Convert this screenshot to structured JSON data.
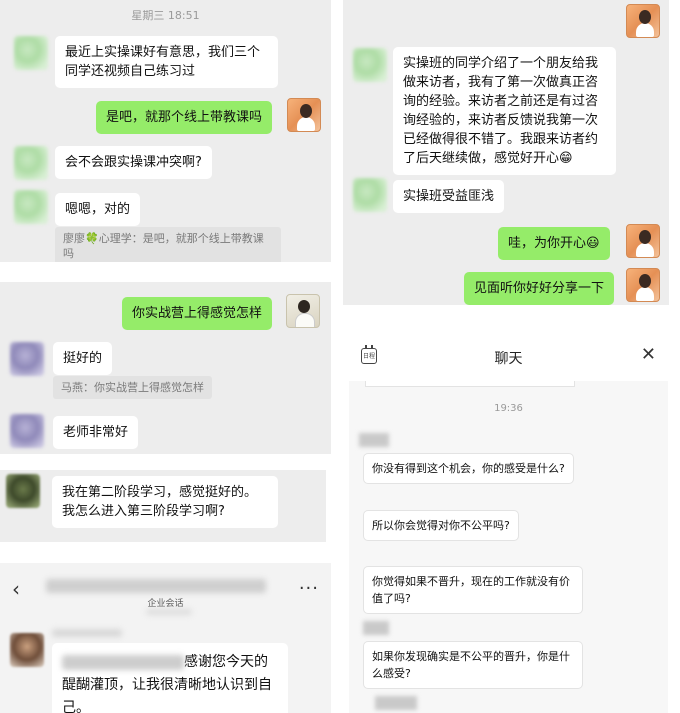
{
  "panel1": {
    "time": "星期三 18:51",
    "msg1": "最近上实操课好有意思，我们三个同学还视频自己练习过",
    "msg2": "是吧，就那个线上带教课吗",
    "msg3": "会不会跟实操课冲突啊?",
    "msg4": "嗯嗯，对的",
    "quote": "廖廖🍀心理学：是吧，就那个线上带教课吗"
  },
  "panel2": {
    "msg1": "你实战营上得感觉怎样",
    "msg2": "挺好的",
    "quote": "马燕：你实战营上得感觉怎样",
    "msg3": "老师非常好"
  },
  "panel3": {
    "msg1_line1": "我在第二阶段学习，感觉挺好的。",
    "msg1_line2": "我怎么进入第三阶段学习啊?"
  },
  "panel4": {
    "back_icon": "‹",
    "more_icon": "···",
    "subtitle": "企业会话",
    "msg_text": "感谢您今天的醍醐灌顶，让我很清晰地认识到自己。"
  },
  "panel5": {
    "msg1": "实操班的同学介绍了一个朋友给我做来访者，我有了第一次做真正咨询的经验。来访者之前还是有过咨询经验的，来访者反馈说我第一次已经做得很不错了。我跟来访者约了后天继续做，感觉好开心😁",
    "msg2": "实操班受益匪浅",
    "msg3": "哇，为你开心😃",
    "msg4": "见面听你好好分享一下"
  },
  "panel6": {
    "title": "聊天",
    "close_icon": "✕",
    "cal_text": "日程",
    "time": "19:36",
    "msg1": "你没有得到这个机会，你的感受是什么?",
    "msg2": "所以你会觉得对你不公平吗?",
    "msg3": "你觉得如果不晋升，现在的工作就没有价值了吗?",
    "msg4": "如果你发现确实是不公平的晋升，你是什么感受?"
  },
  "colors": {
    "self_bubble": "#95ec69",
    "other_bubble": "#ffffff",
    "chat_bg": "#ededed",
    "heart": "#e53950"
  }
}
